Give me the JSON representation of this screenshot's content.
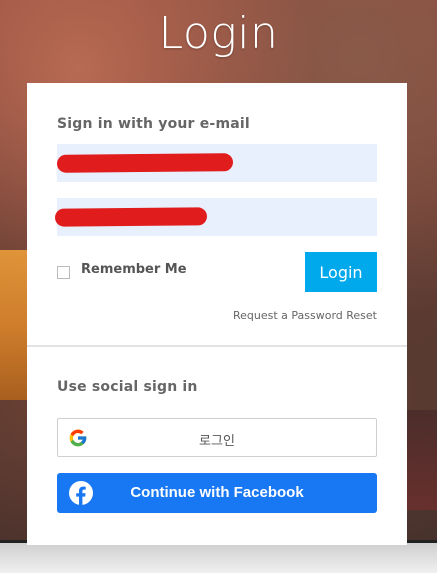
{
  "page": {
    "title": "Login"
  },
  "email_section": {
    "title": "Sign in with your e-mail",
    "email_value": "",
    "password_value": "",
    "remember_label": "Remember Me",
    "login_label": "Login",
    "reset_link": "Request a Password Reset"
  },
  "social_section": {
    "title": "Use social sign in",
    "google_label": "로그인",
    "facebook_label": "Continue with Facebook"
  },
  "colors": {
    "login_button": "#00a8ec",
    "facebook_button": "#1877f2",
    "input_background": "#e8f0fe",
    "redaction": "#e01c1c"
  },
  "icons": {
    "google": "google-g-icon",
    "facebook": "facebook-f-icon"
  }
}
